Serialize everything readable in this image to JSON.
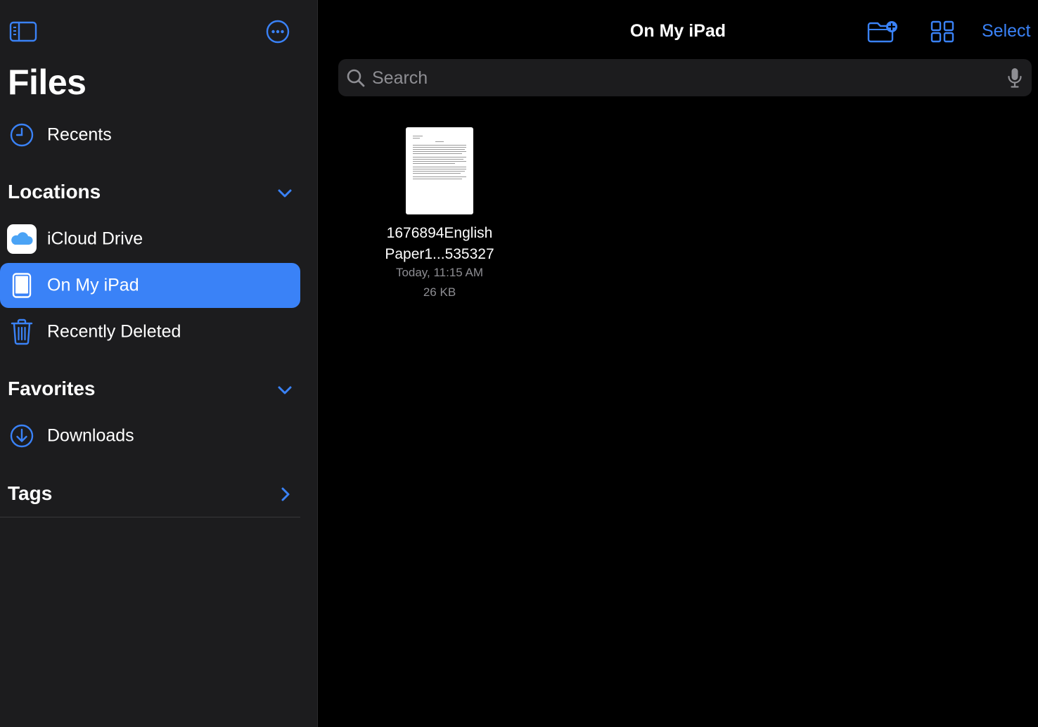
{
  "sidebar": {
    "app_title": "Files",
    "recents": {
      "label": "Recents",
      "icon": "clock-icon"
    },
    "locations": {
      "header": "Locations",
      "items": [
        {
          "label": "iCloud Drive",
          "icon": "icloud-icon"
        },
        {
          "label": "On My iPad",
          "icon": "ipad-icon",
          "selected": true
        },
        {
          "label": "Recently Deleted",
          "icon": "trash-icon"
        }
      ]
    },
    "favorites": {
      "header": "Favorites",
      "items": [
        {
          "label": "Downloads",
          "icon": "download-icon"
        }
      ]
    },
    "tags": {
      "header": "Tags"
    }
  },
  "header": {
    "title": "On My iPad",
    "select_label": "Select"
  },
  "search": {
    "placeholder": "Search",
    "value": ""
  },
  "files": [
    {
      "name_line1": "1676894English",
      "name_line2": "Paper1...535327",
      "date": "Today, 11:15 AM",
      "size": "26 KB"
    }
  ],
  "colors": {
    "accent": "#3a82f7",
    "sidebar_bg": "#1c1c1e",
    "main_bg": "#000000",
    "secondary_text": "#8e8e93"
  }
}
